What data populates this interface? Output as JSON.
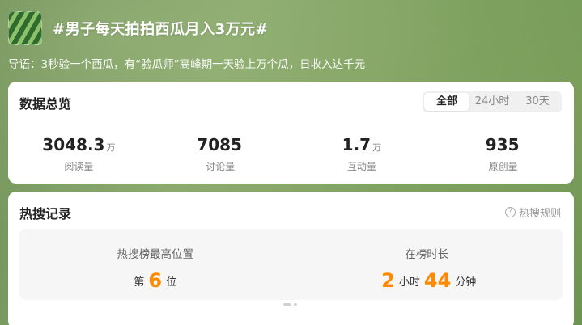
{
  "topic": {
    "title": "#男子每天拍拍西瓜月入3万元#",
    "intro": "导语：3秒验一个西瓜，有“验瓜师”高峰期一天验上万个瓜，日收入达千元"
  },
  "overview": {
    "title": "数据总览",
    "tabs": [
      {
        "label": "全部",
        "active": true
      },
      {
        "label": "24小时",
        "active": false
      },
      {
        "label": "30天",
        "active": false
      }
    ],
    "stats": [
      {
        "value": "3048.3",
        "unit": "万",
        "label": "阅读量"
      },
      {
        "value": "7085",
        "unit": "",
        "label": "讨论量"
      },
      {
        "value": "1.7",
        "unit": "万",
        "label": "互动量"
      },
      {
        "value": "935",
        "unit": "",
        "label": "原创量"
      }
    ]
  },
  "hot": {
    "title": "热搜记录",
    "rules_label": "热搜规则",
    "rules_icon": "?",
    "peak": {
      "label": "热搜榜最高位置",
      "prefix": "第",
      "value": "6",
      "suffix": "位"
    },
    "duration": {
      "label": "在榜时长",
      "hours": "2",
      "hours_unit": "小时",
      "minutes": "44",
      "minutes_unit": "分钟"
    }
  },
  "colors": {
    "accent": "#ff8a00",
    "background": "#7fa262"
  }
}
